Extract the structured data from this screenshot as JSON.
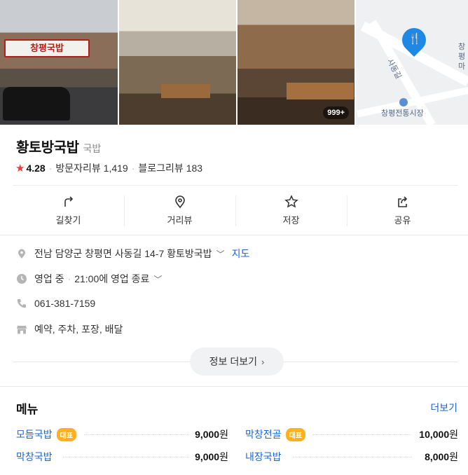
{
  "photos": {
    "sign_text": "창평국밥",
    "count_badge": "999+",
    "map_labels": {
      "market": "창평전통시장",
      "road": "사동길",
      "partial": "창평 마"
    },
    "pin_glyph": "🍴"
  },
  "place": {
    "name": "황토방국밥",
    "category": "국밥",
    "rating": "4.28",
    "visitor_reviews_label": "방문자리뷰",
    "visitor_reviews_count": "1,419",
    "blog_reviews_label": "블로그리뷰",
    "blog_reviews_count": "183"
  },
  "actions": [
    {
      "label": "길찾기",
      "icon": "directions-icon"
    },
    {
      "label": "거리뷰",
      "icon": "location-pin-icon"
    },
    {
      "label": "저장",
      "icon": "star-outline-icon"
    },
    {
      "label": "공유",
      "icon": "share-icon"
    }
  ],
  "info": {
    "address": "전남 담양군 창평면 사동길 14-7 황토방국밥",
    "map_link": "지도",
    "status": "영업 중",
    "hours": "21:00에 영업 종료",
    "phone": "061-381-7159",
    "amenities": "예약, 주차, 포장, 배달"
  },
  "more_info_label": "정보 더보기",
  "menu": {
    "title": "메뉴",
    "more_label": "더보기",
    "badge_label": "대표",
    "items": [
      {
        "name": "모듬국밥",
        "price": "9,000",
        "unit": "원",
        "representative": true
      },
      {
        "name": "막창전골",
        "price": "10,000",
        "unit": "원",
        "representative": true
      },
      {
        "name": "막창국밥",
        "price": "9,000",
        "unit": "원",
        "representative": false
      },
      {
        "name": "내장국밥",
        "price": "8,000",
        "unit": "원",
        "representative": false
      }
    ]
  },
  "colors": {
    "accent_blue": "#1a64d6",
    "star_red": "#f23b3b",
    "badge_orange": "#ffb020",
    "map_pin": "#1e88e5"
  }
}
